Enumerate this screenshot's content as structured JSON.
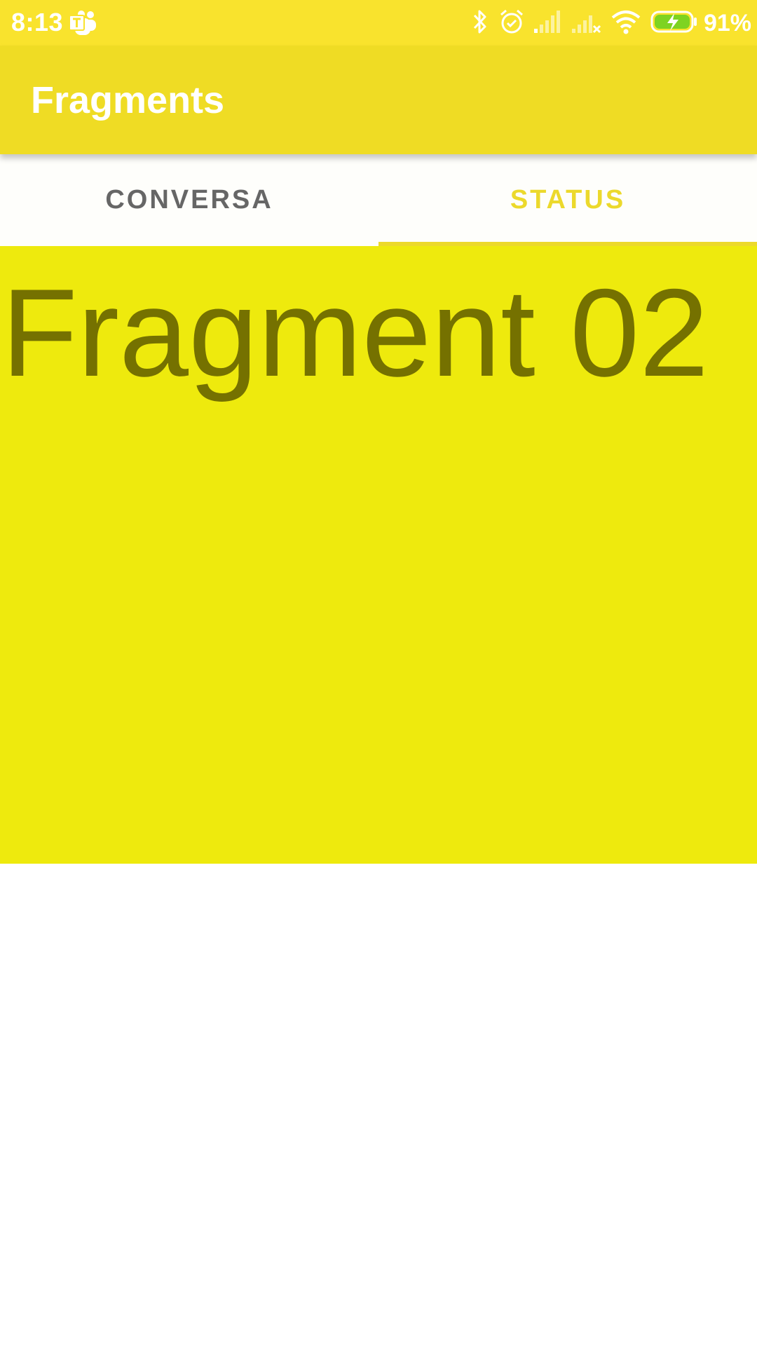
{
  "status_bar": {
    "time": "8:13",
    "battery_percent": "91%",
    "icons": [
      "teams-icon",
      "bluetooth-icon",
      "alarm-icon",
      "signal-icon",
      "signal-no-service-icon",
      "wifi-icon",
      "battery-charging-icon"
    ]
  },
  "app_bar": {
    "title": "Fragments"
  },
  "tabs": [
    {
      "label": "CONVERSA",
      "selected": false
    },
    {
      "label": "STATUS",
      "selected": true
    }
  ],
  "fragment": {
    "text": "Fragment 02"
  },
  "colors": {
    "status_bar": "#f9e32d",
    "app_bar": "#efdc24",
    "tab_active": "#ecd92c",
    "tab_inactive": "#666666",
    "fragment_bg": "#eeea0d",
    "fragment_text": "#757100"
  }
}
